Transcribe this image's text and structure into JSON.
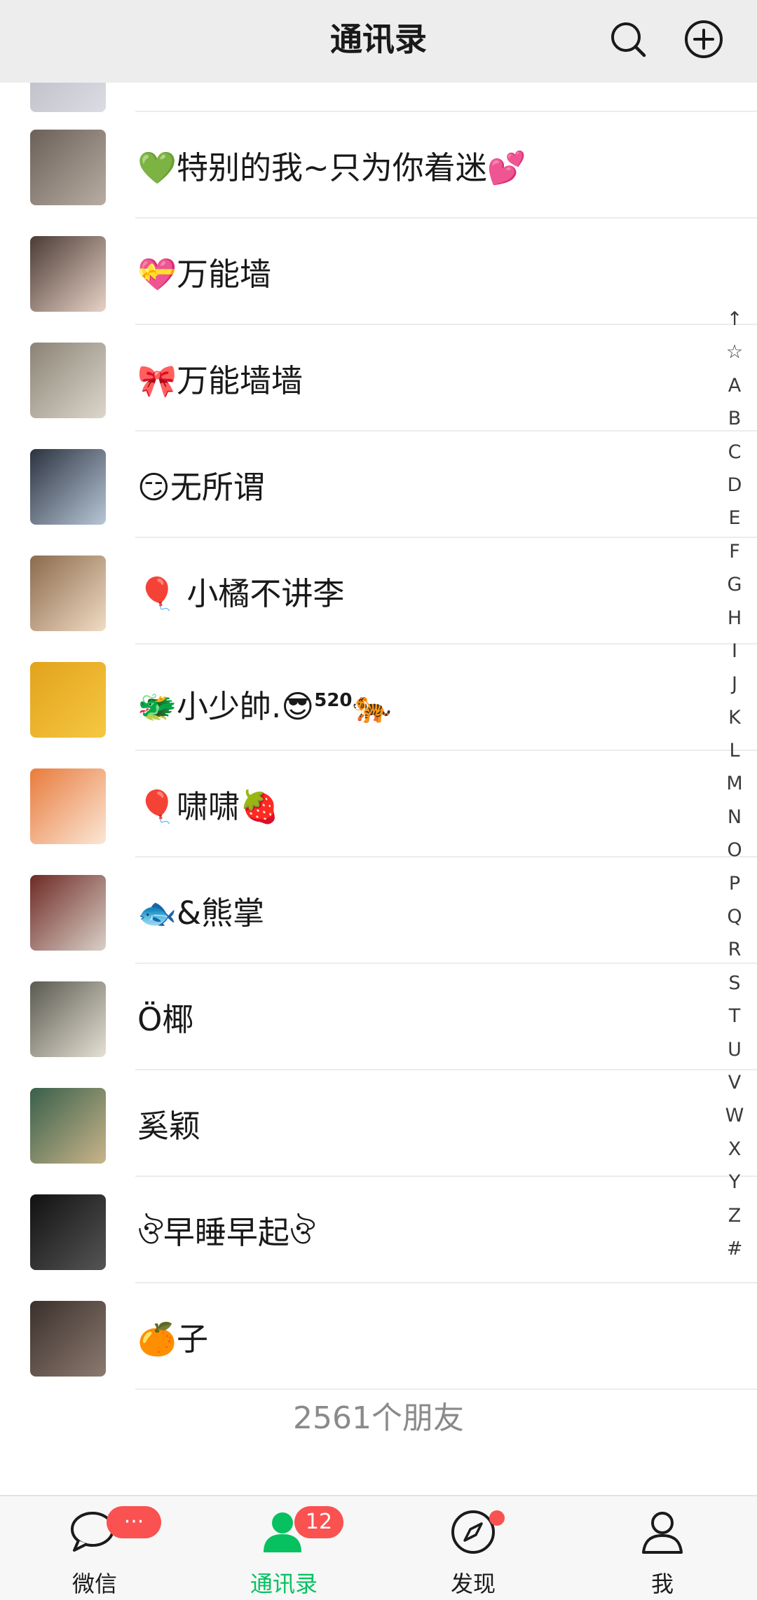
{
  "header": {
    "title": "通讯录",
    "search_icon": "search-icon",
    "add_icon": "plus-circle-icon"
  },
  "contacts": [
    {
      "name": "",
      "avatar": [
        "#b7b7c0",
        "#dcdce4"
      ]
    },
    {
      "name": "💚特别的我~只为你着迷💕",
      "avatar": [
        "#6b6058",
        "#b8ada2"
      ]
    },
    {
      "name": "💝万能墙",
      "avatar": [
        "#4a3b35",
        "#e8d2c6"
      ]
    },
    {
      "name": "🎀万能墙墙",
      "avatar": [
        "#8a8375",
        "#ddd6cc"
      ]
    },
    {
      "name": "😏无所谓",
      "avatar": [
        "#2c3340",
        "#b7c6d6"
      ]
    },
    {
      "name": "🎈 小橘不讲李",
      "avatar": [
        "#8c6a4c",
        "#f0dcc4"
      ]
    },
    {
      "name": "🐲小少帥.😎",
      "sup": "520",
      "after": "🐅",
      "avatar": [
        "#e3a21c",
        "#f5c842"
      ]
    },
    {
      "name": "🎈啸啸🍓",
      "avatar": [
        "#e87b3c",
        "#fbe7d6"
      ]
    },
    {
      "name": "🐟&熊掌",
      "avatar": [
        "#6e2a24",
        "#d9d0c8"
      ]
    },
    {
      "name": "Ö椰",
      "avatar": [
        "#5a5a50",
        "#e6e0d4"
      ]
    },
    {
      "name": "奚颖",
      "avatar": [
        "#39604a",
        "#c9b48a"
      ]
    },
    {
      "name": "ঔ早睡早起ঔ",
      "avatar": [
        "#111111",
        "#555555"
      ]
    },
    {
      "name": "🍊子",
      "avatar": [
        "#3b302c",
        "#8c7a70"
      ]
    }
  ],
  "footer": {
    "count_text": "2561个朋友"
  },
  "index_bar": [
    "↑",
    "☆",
    "A",
    "B",
    "C",
    "D",
    "E",
    "F",
    "G",
    "H",
    "I",
    "J",
    "K",
    "L",
    "M",
    "N",
    "O",
    "P",
    "Q",
    "R",
    "S",
    "T",
    "U",
    "V",
    "W",
    "X",
    "Y",
    "Z",
    "#"
  ],
  "tabs": [
    {
      "label": "微信",
      "icon": "chat-bubble-icon",
      "badge": "···",
      "active": false
    },
    {
      "label": "通讯录",
      "icon": "contacts-icon",
      "badge": "12",
      "active": true
    },
    {
      "label": "发现",
      "icon": "compass-icon",
      "dot": true,
      "active": false
    },
    {
      "label": "我",
      "icon": "person-icon",
      "active": false
    }
  ],
  "colors": {
    "accent": "#07c160",
    "badge": "#fa5151",
    "header_bg": "#ededed",
    "tabbar_bg": "#f7f7f7"
  }
}
